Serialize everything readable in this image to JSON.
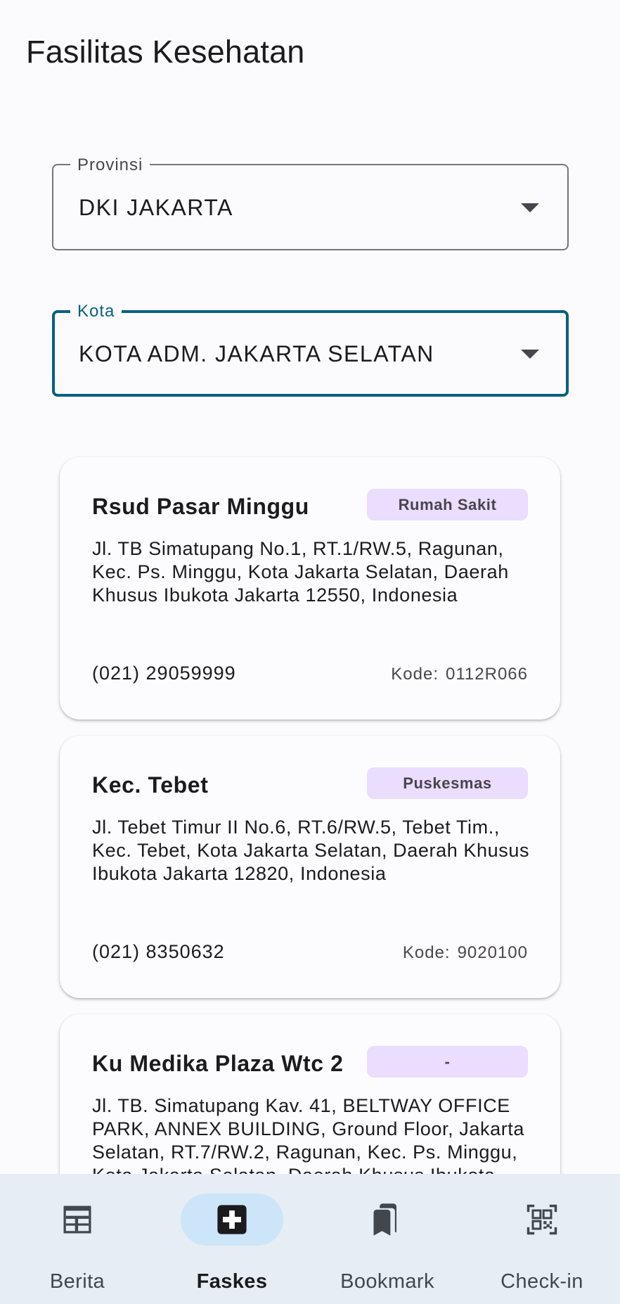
{
  "header": {
    "title": "Fasilitas Kesehatan"
  },
  "filters": {
    "province": {
      "label": "Provinsi",
      "value": "DKI JAKARTA"
    },
    "city": {
      "label": "Kota",
      "value": "KOTA ADM. JAKARTA SELATAN"
    }
  },
  "facilities": [
    {
      "name": "Rsud Pasar Minggu",
      "type": "Rumah Sakit",
      "address": "Jl. TB Simatupang No.1, RT.1/RW.5, Ragunan, Kec. Ps. Minggu, Kota Jakarta Selatan, Daerah Khusus Ibukota Jakarta 12550, Indonesia",
      "phone": "(021) 29059999",
      "code_label": "Kode:",
      "code": "0112R066"
    },
    {
      "name": "Kec. Tebet",
      "type": "Puskesmas",
      "address": "Jl. Tebet Timur II No.6, RT.6/RW.5, Tebet Tim., Kec. Tebet, Kota Jakarta Selatan, Daerah Khusus Ibukota Jakarta 12820, Indonesia",
      "phone": "(021) 8350632",
      "code_label": "Kode:",
      "code": "9020100"
    },
    {
      "name": "Ku Medika Plaza Wtc 2",
      "type": "-",
      "address": "Jl. TB. Simatupang Kav. 41, BELTWAY OFFICE PARK, ANNEX BUILDING, Ground Floor, Jakarta Selatan, RT.7/RW.2, Ragunan, Kec. Ps. Minggu, Kota Jakarta Selatan, Daerah Khusus Ibukota"
    }
  ],
  "bottom_nav": {
    "items": [
      {
        "label": "Berita",
        "icon": "newspaper-icon",
        "active": false
      },
      {
        "label": "Faskes",
        "icon": "medical-cross-icon",
        "active": true
      },
      {
        "label": "Bookmark",
        "icon": "bookmarks-icon",
        "active": false
      },
      {
        "label": "Check-in",
        "icon": "qr-code-icon",
        "active": false
      }
    ]
  },
  "colors": {
    "background": "#fbfbfd",
    "accent": "#0a6080",
    "badge": "#eaddfd",
    "nav_background": "#e6edf4",
    "nav_active_pill": "#cde5f8"
  }
}
